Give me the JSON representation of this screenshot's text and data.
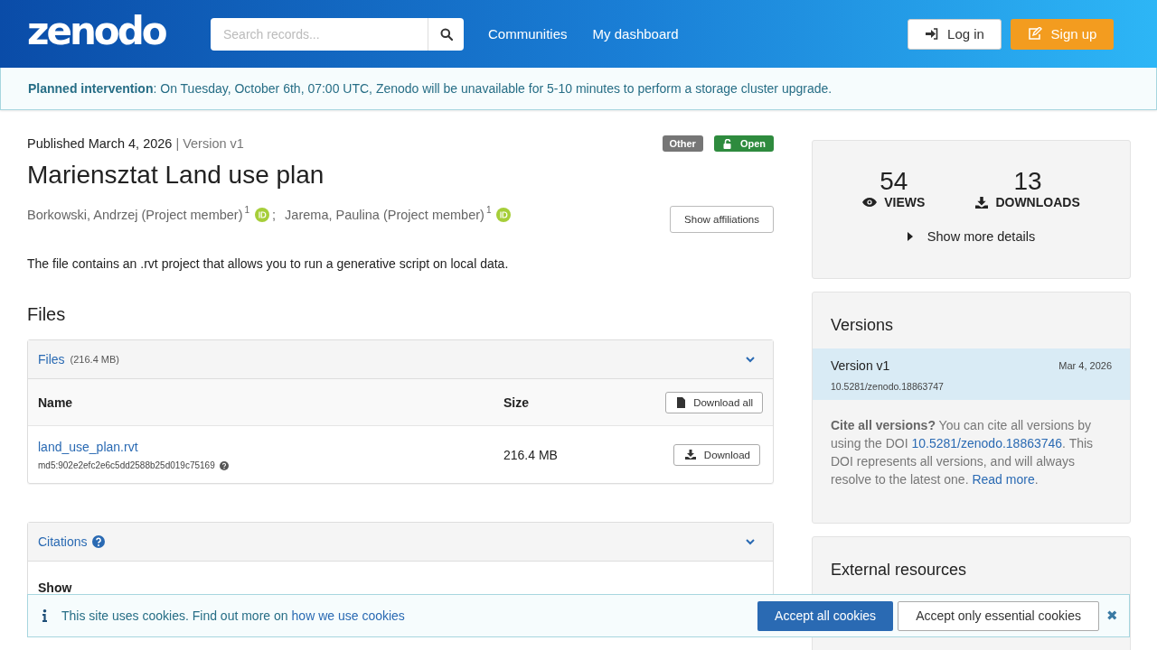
{
  "header": {
    "logo": "zenodo",
    "search": {
      "placeholder": "Search records..."
    },
    "nav": [
      "Communities",
      "My dashboard"
    ],
    "login": "Log in",
    "signup": "Sign up"
  },
  "banner": "**Planned intervention**: On Tuesday, October 6th, 07:00 UTC, Zenodo will be unavailable for 5-10 minutes to perform a storage cluster upgrade.",
  "record": {
    "published": "Published March 4, 2026",
    "divider": "|",
    "version": "Version v1",
    "badges": [
      {
        "label": "Other",
        "kind": "type"
      },
      {
        "label": "Open",
        "kind": "access"
      }
    ],
    "title": "Mariensztat Land use plan",
    "creators": [
      {
        "name": "Borkowski, Andrzej (Project member)",
        "sup": "1",
        "separator": ";"
      },
      {
        "name": "Jarema, Paulina (Project member)",
        "sup": "1"
      }
    ],
    "show_affiliations": "Show affiliations",
    "description": "The file contains an .rvt project that allows you to run a generative script on local data."
  },
  "files": {
    "heading": "Files",
    "panel_title": "Files",
    "panel_size": "(216.4 MB)",
    "columns": [
      "Name",
      "Size"
    ],
    "download_all": "Download all",
    "rows": [
      {
        "name": "land_use_plan.rvt",
        "checksum": "md5:902e2efc2e6c5dd2588b25d019c75169",
        "size": "216.4 MB",
        "action": "Download"
      }
    ]
  },
  "citations": {
    "title": "Citations",
    "show": "Show"
  },
  "stats": {
    "views": "54",
    "views_label": "VIEWS",
    "downloads": "13",
    "downloads_label": "DOWNLOADS",
    "more": "Show more details"
  },
  "versions": {
    "title": "Versions",
    "items": [
      {
        "name": "Version v1",
        "date": "Mar 4, 2026",
        "doi": "10.5281/zenodo.18863747",
        "selected": true
      }
    ],
    "cite_bold": "Cite all versions?",
    "cite_text": "You can cite all versions by using the DOI",
    "cite_doi": "10.5281/zenodo.18863746",
    "cite_text2": ". This DOI represents all versions, and will always resolve to the latest one.",
    "read_more": "Read more",
    "period": "."
  },
  "external": {
    "title": "External resources"
  },
  "cookies": {
    "text": "This site uses cookies. Find out more on",
    "link": "how we use cookies",
    "accept_all": "Accept all cookies",
    "accept_essential": "Accept only essential cookies",
    "close": "✖"
  }
}
